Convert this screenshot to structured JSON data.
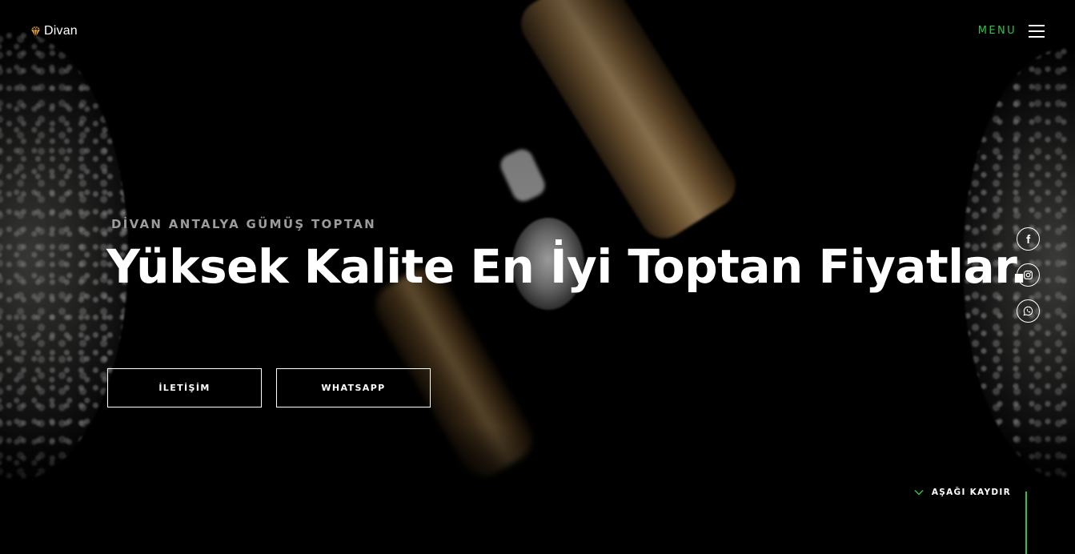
{
  "header": {
    "logo_text": "Divan",
    "menu_label": "MENU"
  },
  "hero": {
    "eyebrow": "DİVAN ANTALYA GÜMÜŞ TOPTAN",
    "headline": "Yüksek Kalite En İyi Toptan Fiyatlar.",
    "buttons": {
      "contact_label": "İLETİŞİM",
      "whatsapp_label": "WHATSAPP"
    }
  },
  "social": {
    "items": [
      "facebook-icon",
      "instagram-icon",
      "whatsapp-icon"
    ]
  },
  "scroll": {
    "label": "AŞAĞI KAYDIR"
  },
  "colors": {
    "accent": "#2fc34a",
    "background": "#000000",
    "text": "#ffffff",
    "logo_gem": "#e0a23a"
  }
}
